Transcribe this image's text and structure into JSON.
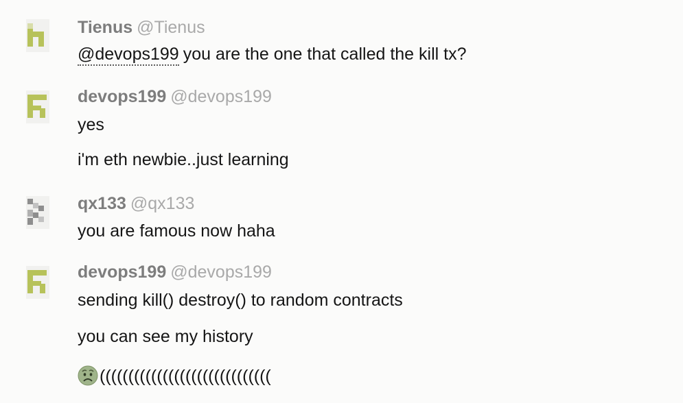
{
  "messages": [
    {
      "author": "Tienus",
      "handle": "@Tienus",
      "avatar_icon": "identicon-tienus",
      "avatar_color": "#b7c25a",
      "lines": [
        {
          "mention": "@devops199",
          "text": "you are the one that called the kill tx?"
        }
      ]
    },
    {
      "author": "devops199",
      "handle": "@devops199",
      "avatar_icon": "identicon-devops199",
      "avatar_color": "#b7c25a",
      "lines": [
        {
          "text": "yes"
        },
        {
          "text": "i'm eth newbie..just learning"
        }
      ]
    },
    {
      "author": "qx133",
      "handle": "@qx133",
      "avatar_icon": "identicon-qx133",
      "avatar_color": "#8e8e8e",
      "lines": [
        {
          "text": "you are famous now haha"
        }
      ]
    },
    {
      "author": "devops199",
      "handle": "@devops199",
      "avatar_icon": "identicon-devops199",
      "avatar_color": "#b7c25a",
      "lines": [
        {
          "text": "sending kill() destroy() to random contracts"
        },
        {
          "text": "you can see my history"
        },
        {
          "emoji": "worried-face-emoji",
          "text": "(((((((((((((((((((((((((((((("
        }
      ]
    }
  ]
}
